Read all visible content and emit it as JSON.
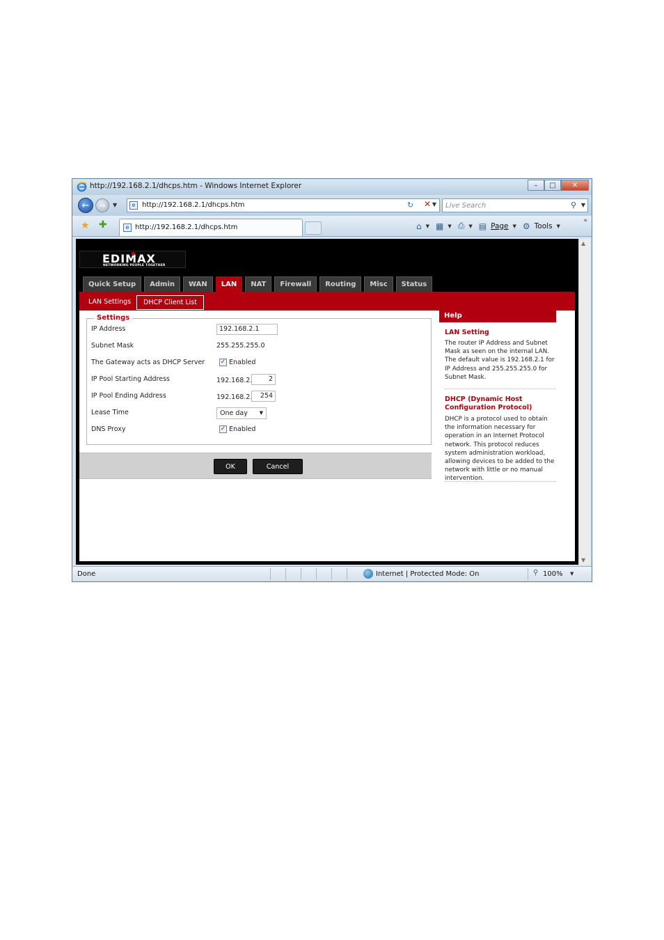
{
  "window": {
    "title": "http://192.168.2.1/dhcps.htm - Windows Internet Explorer",
    "url": "http://192.168.2.1/dhcps.htm",
    "search_placeholder": "Live Search",
    "tab_title": "http://192.168.2.1/dhcps.htm",
    "page_menu": "Page",
    "tools_menu": "Tools"
  },
  "brand": {
    "name": "EDIMAX",
    "tagline": "NETWORKING PEOPLE TOGETHER"
  },
  "nav_tabs": [
    "Quick Setup",
    "Admin",
    "WAN",
    "LAN",
    "NAT",
    "Firewall",
    "Routing",
    "Misc",
    "Status"
  ],
  "active_tab": "LAN",
  "sub_tabs": {
    "lan_settings": "LAN Settings",
    "dhcp_client_list": "DHCP Client List"
  },
  "settings": {
    "legend": "Settings",
    "ip_address": {
      "label": "IP Address",
      "value": "192.168.2.1"
    },
    "subnet_mask": {
      "label": "Subnet Mask",
      "value": "255.255.255.0"
    },
    "dhcp_server": {
      "label": "The Gateway acts as DHCP Server",
      "checked": true,
      "option": "Enabled"
    },
    "pool_start": {
      "label": "IP Pool Starting Address",
      "prefix": "192.168.2.",
      "value": "2"
    },
    "pool_end": {
      "label": "IP Pool Ending Address",
      "prefix": "192.168.2.",
      "value": "254"
    },
    "lease_time": {
      "label": "Lease Time",
      "value": "One day"
    },
    "dns_proxy": {
      "label": "DNS Proxy",
      "checked": true,
      "option": "Enabled"
    }
  },
  "buttons": {
    "ok": "OK",
    "cancel": "Cancel"
  },
  "help": {
    "header": "Help",
    "lan_title": "LAN Setting",
    "lan_text": "The router IP Address and Subnet Mask as seen on the internal LAN. The default value is 192.168.2.1 for IP Address and 255.255.255.0 for Subnet Mask.",
    "dhcp_title": "DHCP (Dynamic Host Configuration Protocol)",
    "dhcp_text": "DHCP is a protocol used to obtain the information necessary for operation in an Internet Protocol network. This protocol reduces system administration workload, allowing devices to be added to the network with little or no manual intervention."
  },
  "status": {
    "text": "Done",
    "zone": "Internet | Protected Mode: On",
    "zoom": "100%"
  },
  "colors": {
    "brand_red": "#b3000e",
    "page_black": "#000000"
  }
}
